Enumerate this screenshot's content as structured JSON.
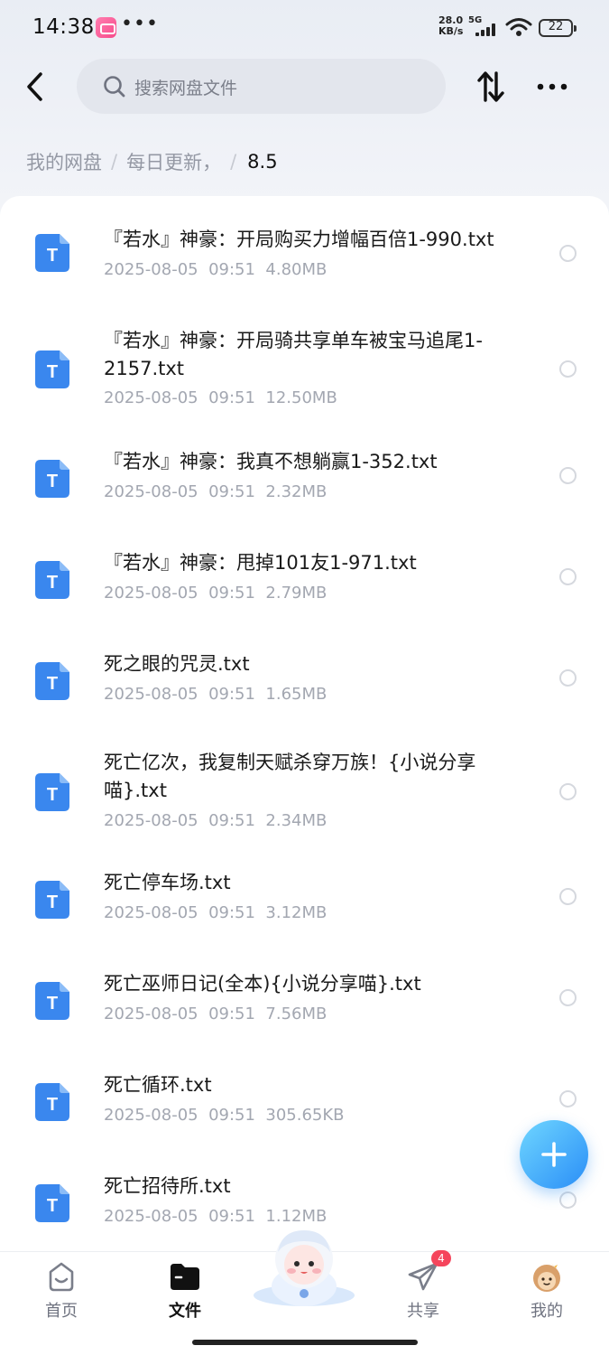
{
  "status_bar": {
    "time": "14:38",
    "more_dots": "•••",
    "net_speed_value": "28.0",
    "net_speed_unit": "KB/s",
    "network": "5G",
    "battery": "22"
  },
  "header": {
    "search_placeholder": "搜索网盘文件"
  },
  "breadcrumb": {
    "items": [
      "我的网盘",
      "每日更新，"
    ],
    "separator": "/",
    "current": "8.5"
  },
  "files": [
    {
      "name": "『若水』神豪：开局购买力增幅百倍1-990.txt",
      "date": "2025-08-05",
      "time": "09:51",
      "size": "4.80MB"
    },
    {
      "name": "『若水』神豪：开局骑共享单车被宝马追尾1-2157.txt",
      "date": "2025-08-05",
      "time": "09:51",
      "size": "12.50MB"
    },
    {
      "name": "『若水』神豪：我真不想躺赢1-352.txt",
      "date": "2025-08-05",
      "time": "09:51",
      "size": "2.32MB"
    },
    {
      "name": "『若水』神豪：甩掉101友1-971.txt",
      "date": "2025-08-05",
      "time": "09:51",
      "size": "2.79MB"
    },
    {
      "name": "死之眼的咒灵.txt",
      "date": "2025-08-05",
      "time": "09:51",
      "size": "1.65MB"
    },
    {
      "name": "死亡亿次，我复制天赋杀穿万族！{小说分享喵}.txt",
      "date": "2025-08-05",
      "time": "09:51",
      "size": "2.34MB"
    },
    {
      "name": "死亡停车场.txt",
      "date": "2025-08-05",
      "time": "09:51",
      "size": "3.12MB"
    },
    {
      "name": "死亡巫师日记(全本){小说分享喵}.txt",
      "date": "2025-08-05",
      "time": "09:51",
      "size": "7.56MB"
    },
    {
      "name": "死亡循环.txt",
      "date": "2025-08-05",
      "time": "09:51",
      "size": "305.65KB"
    },
    {
      "name": "死亡招待所.txt",
      "date": "2025-08-05",
      "time": "09:51",
      "size": "1.12MB"
    }
  ],
  "file_icon_letter": "T",
  "bottom_nav": {
    "home": "首页",
    "files": "文件",
    "share": "共享",
    "share_badge": "4",
    "me": "我的"
  },
  "colors": {
    "accent": "#2a8ef7",
    "file_icon": "#3a87ee",
    "badge": "#f5455c"
  }
}
